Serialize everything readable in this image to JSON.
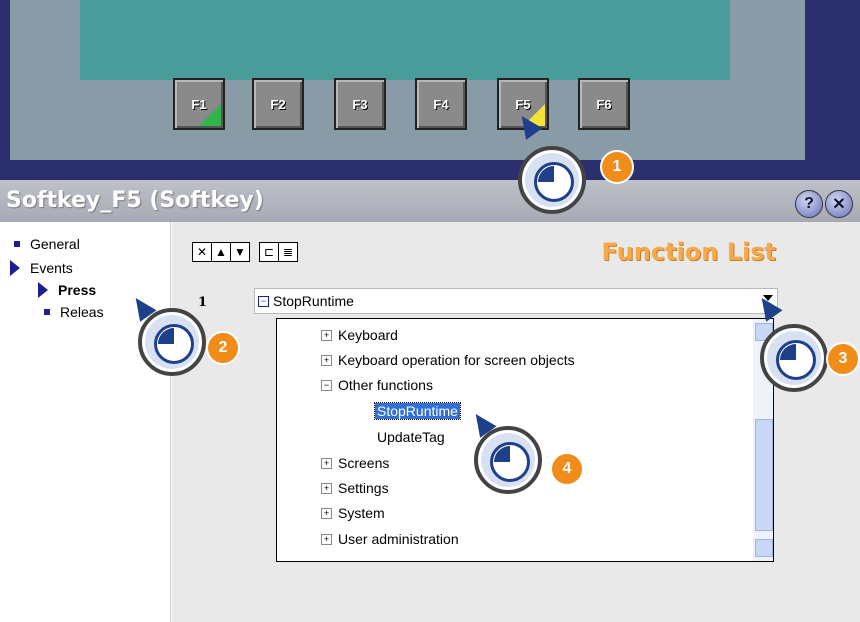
{
  "fkeys": [
    "F1",
    "F2",
    "F3",
    "F4",
    "F5",
    "F6"
  ],
  "window": {
    "title": "Softkey_F5 (Softkey)",
    "help_icon": "help-icon",
    "close_icon": "close-icon"
  },
  "tree": {
    "general": "General",
    "events": "Events",
    "press": "Press",
    "release": "Releas"
  },
  "toolbar": {
    "icons": [
      "delete-icon",
      "move-up-icon",
      "move-down-icon",
      "indent-icon",
      "list-icon"
    ]
  },
  "function_list": {
    "heading": "Function List",
    "row_number": "1",
    "row_function": "StopRuntime"
  },
  "dropdown": {
    "items": [
      "Keyboard",
      "Keyboard operation for screen objects",
      "Other functions",
      "StopRuntime",
      "UpdateTag",
      "Screens",
      "Settings",
      "System",
      "User administration"
    ]
  },
  "callouts": [
    "1",
    "2",
    "3",
    "4"
  ],
  "colors": {
    "accent_orange": "#f08c1a",
    "heading_orange": "#f5a94a",
    "selection_blue": "#2f6fd6",
    "panel_navy": "#2b2f6e"
  }
}
